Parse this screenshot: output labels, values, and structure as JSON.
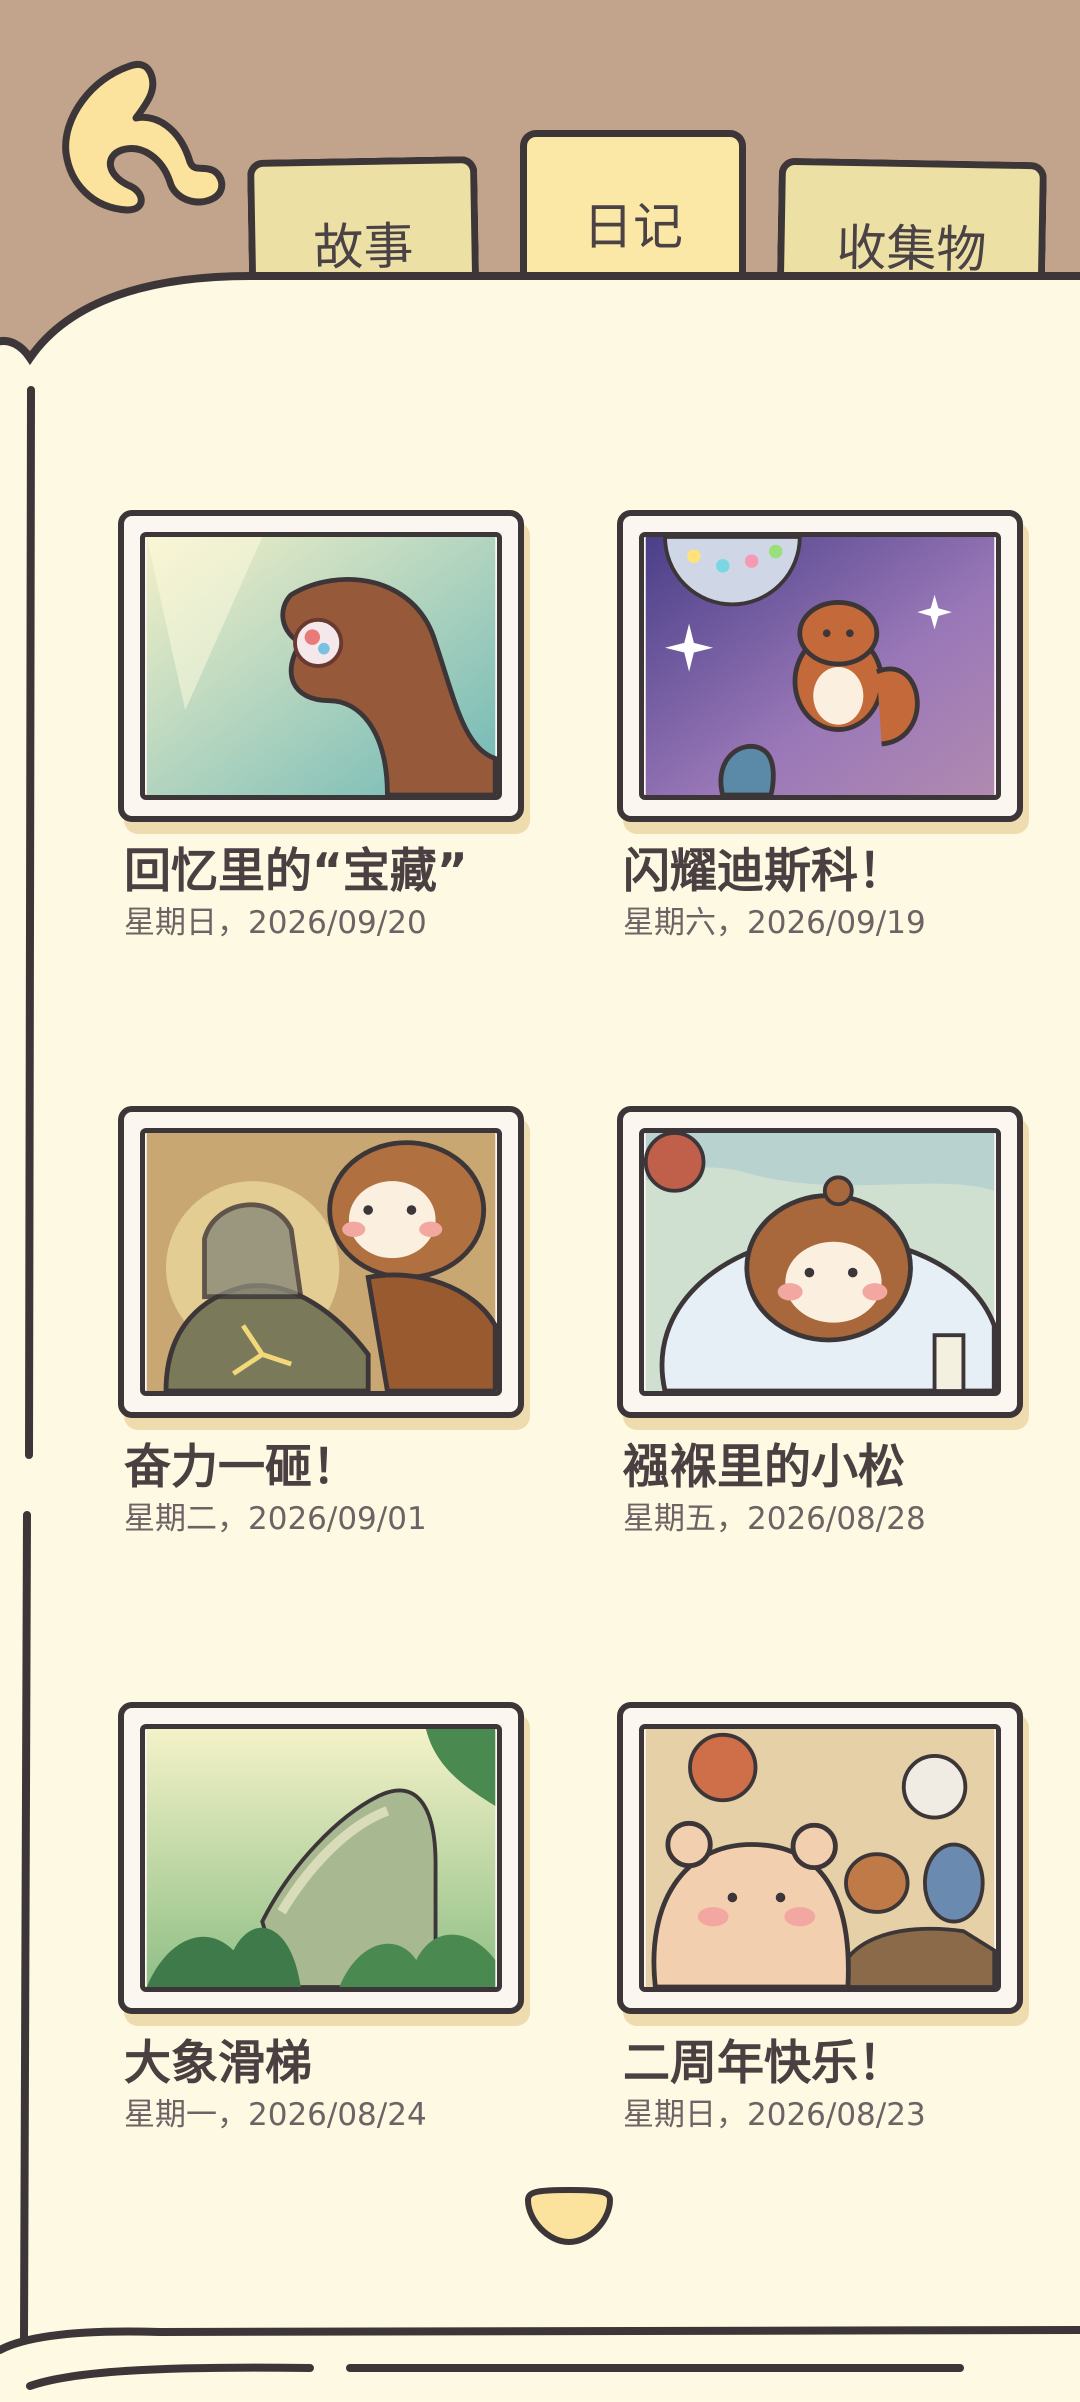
{
  "tabs": [
    {
      "label": "故事",
      "active": false
    },
    {
      "label": "日记",
      "active": true
    },
    {
      "label": "收集物",
      "active": false
    }
  ],
  "colors": {
    "background": "#c2a38c",
    "page": "#fdf9e2",
    "ink": "#3d3638",
    "tab_active": "#fbe8a6",
    "tab": "#ede0a5"
  },
  "diary": [
    {
      "title": "回忆里的“宝藏”",
      "date": "星期日，2026/09/20",
      "image": "squirrel-paw-holding-marble"
    },
    {
      "title": "闪耀迪斯科！",
      "date": "星期六，2026/09/19",
      "image": "squirrel-dancing-disco-ball"
    },
    {
      "title": "奋力一砸！",
      "date": "星期二，2026/09/01",
      "image": "squirrel-smashing-rock"
    },
    {
      "title": "襁褓里的小松",
      "date": "星期五，2026/08/28",
      "image": "squirrel-in-swaddle"
    },
    {
      "title": "大象滑梯",
      "date": "星期一，2026/08/24",
      "image": "elephant-slide-jungle"
    },
    {
      "title": "二周年快乐！",
      "date": "星期日，2026/08/23",
      "image": "anniversary-party-friends"
    }
  ]
}
